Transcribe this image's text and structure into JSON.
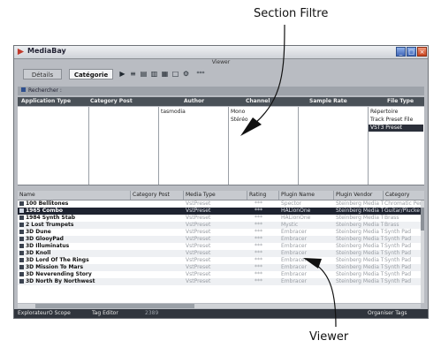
{
  "callouts": {
    "top": "Section Filtre",
    "bottom": "Viewer"
  },
  "window": {
    "title": "MediaBay",
    "subtitle": "Viewer",
    "controls": [
      "_",
      "□",
      "×"
    ]
  },
  "toolbar": {
    "tabs": [
      "Détails",
      "Catégorie"
    ],
    "active_tab": "Catégorie",
    "icons": [
      "play-icon",
      "filter-icon",
      "layout-icon",
      "columns-icon",
      "grid-icon",
      "window-icon",
      "gear-icon",
      "more-icon"
    ],
    "extra": "***"
  },
  "search": {
    "label": "Rechercher :"
  },
  "filter": {
    "headers": [
      "Application Type",
      "Category Post",
      "Author",
      "Channel",
      "Sample Rate",
      "File Type"
    ],
    "author_items": [
      "tasmodia"
    ],
    "channel_items": [
      "Mono",
      "Stéréo"
    ],
    "filetype_items": [
      "Répertoire",
      "Track Preset File",
      "VST3 Preset"
    ],
    "filetype_selected": "VST3 Preset"
  },
  "grid": {
    "headers": [
      "Name",
      "Category Post",
      "Media Type",
      "Rating",
      "Plugin Name",
      "Plugin Vendor",
      "Category"
    ],
    "rows": [
      {
        "name": "100 Bellitones",
        "type": "VstPreset",
        "rating": "***",
        "plugin": "Spector",
        "vendor": "Steinberg Media Tec",
        "category": "Chromatic Per"
      },
      {
        "name": "1965 Combo",
        "type": "VstPreset",
        "rating": "***",
        "plugin": "HALionOne",
        "vendor": "Steinberg Media Tec",
        "category": "Guitar/Plucke"
      },
      {
        "name": "1984 Synth Stab",
        "type": "VstPreset",
        "rating": "***",
        "plugin": "HALionOne",
        "vendor": "Steinberg Media Tec",
        "category": "Brass"
      },
      {
        "name": "2 Lost Trumpets",
        "type": "VstPreset",
        "rating": "***",
        "plugin": "Mystic",
        "vendor": "Steinberg Media Tec",
        "category": "Brass"
      },
      {
        "name": "3D Dune",
        "type": "VstPreset",
        "rating": "***",
        "plugin": "Embracer",
        "vendor": "Steinberg Media Tec",
        "category": "Synth Pad"
      },
      {
        "name": "3D GlooyPad",
        "type": "VstPreset",
        "rating": "***",
        "plugin": "Embracer",
        "vendor": "Steinberg Media Tec",
        "category": "Synth Pad"
      },
      {
        "name": "3D Illuminatus",
        "type": "VstPreset",
        "rating": "***",
        "plugin": "Embracer",
        "vendor": "Steinberg Media Tec",
        "category": "Synth Pad"
      },
      {
        "name": "3D Knoll",
        "type": "VstPreset",
        "rating": "***",
        "plugin": "Embracer",
        "vendor": "Steinberg Media Tec",
        "category": "Synth Pad"
      },
      {
        "name": "3D Lord Of The Rings",
        "type": "VstPreset",
        "rating": "***",
        "plugin": "Embracer",
        "vendor": "Steinberg Media Tec",
        "category": "Synth Pad"
      },
      {
        "name": "3D Mission To Mars",
        "type": "VstPreset",
        "rating": "***",
        "plugin": "Embracer",
        "vendor": "Steinberg Media Tec",
        "category": "Synth Pad"
      },
      {
        "name": "3D Neverending Story",
        "type": "VstPreset",
        "rating": "***",
        "plugin": "Embracer",
        "vendor": "Steinberg Media Tec",
        "category": "Synth Pad"
      },
      {
        "name": "3D North By Northwest",
        "type": "VstPreset",
        "rating": "***",
        "plugin": "Embracer",
        "vendor": "Steinberg Media Tec",
        "category": "Synth Pad"
      }
    ],
    "selected_row": "1965 Combo"
  },
  "statusbar": {
    "explorer": "ExplorateurO Scope",
    "tag_editor": "Tag Editor",
    "count": "2389",
    "organiser": "Organiser Tags"
  },
  "colors": {
    "selection": "#1e2330",
    "header_dark": "#4a5158",
    "window_bg": "#b9bcc2"
  }
}
